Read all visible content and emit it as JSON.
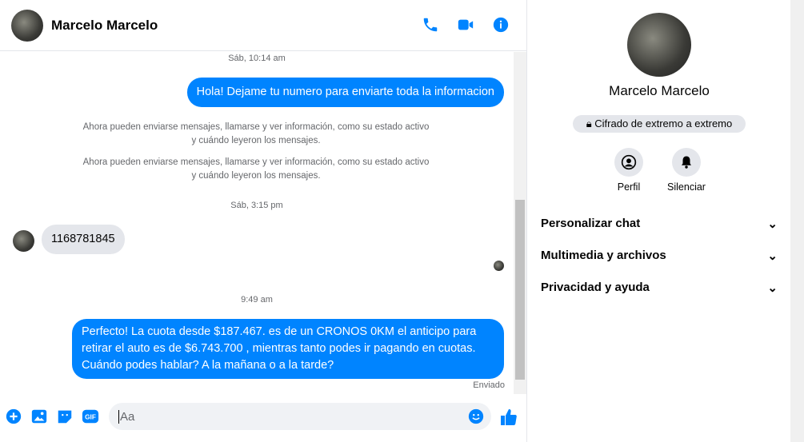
{
  "header": {
    "name": "Marcelo Marcelo"
  },
  "messages": {
    "ts1": "Sáb, 10:14 am",
    "out1": "Hola! Dejame tu numero  para enviarte toda la informacion",
    "sys1": "Ahora pueden enviarse mensajes, llamarse y ver información, como su estado activo y cuándo leyeron los mensajes.",
    "sys2": "Ahora pueden enviarse mensajes, llamarse y ver información, como su estado activo y cuándo leyeron los mensajes.",
    "ts2": "Sáb, 3:15 pm",
    "in1": "1168781845",
    "ts3": "9:49 am",
    "out2": "Perfecto! La cuota desde $187.467. es de un CRONOS 0KM el anticipo para retirar el auto es de $6.743.700 , mientras tanto podes ir pagando en cuotas. Cuándo podes hablar? A la mañana o a la tarde?",
    "status": "Enviado"
  },
  "composer": {
    "placeholder": "Aa"
  },
  "panel": {
    "name": "Marcelo Marcelo",
    "encryption": "Cifrado de extremo a extremo",
    "profile": "Perfil",
    "mute": "Silenciar",
    "sections": [
      "Personalizar chat",
      "Multimedia y archivos",
      "Privacidad y ayuda"
    ]
  }
}
